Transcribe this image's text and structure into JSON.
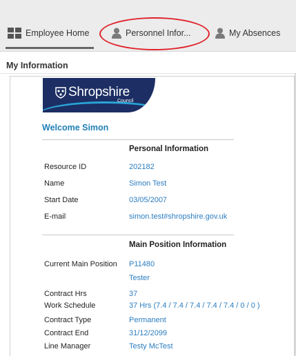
{
  "tabs": [
    {
      "label": "Employee Home",
      "icon": "grid-icon"
    },
    {
      "label": "Personnel Infor...",
      "icon": "person-icon"
    },
    {
      "label": "My Absences",
      "icon": "person-icon"
    }
  ],
  "section": {
    "title": "My Information"
  },
  "logo": {
    "text": "Shropshire",
    "subtext": "Council"
  },
  "welcome": "Welcome Simon",
  "personal": {
    "heading": "Personal Information",
    "rows": [
      {
        "label": "Resource ID",
        "value": "202182"
      },
      {
        "label": "Name",
        "value": "Simon Test"
      },
      {
        "label": "Start Date",
        "value": "03/05/2007"
      },
      {
        "label": "E-mail",
        "value": "simon.test#shropshire.gov.uk"
      }
    ]
  },
  "position": {
    "heading": "Main Position Information",
    "rows": [
      {
        "label": "Current Main Position",
        "value": "P11480"
      },
      {
        "label": "",
        "value": "Tester"
      },
      {
        "label": "Contract Hrs",
        "value": "37"
      },
      {
        "label": "Work Schedule",
        "value": "37 Hrs (7.4 / 7.4 / 7.4 / 7.4 / 7.4 / 0 / 0 )"
      },
      {
        "label": "Contract Type",
        "value": "Permanent"
      },
      {
        "label": "Contract End",
        "value": "31/12/2099"
      },
      {
        "label": "Line Manager",
        "value": "Testy McTest"
      }
    ]
  },
  "colors": {
    "accent": "#1f7fb8",
    "highlight": "#e0222b",
    "logo_bg": "#1c2e63"
  }
}
